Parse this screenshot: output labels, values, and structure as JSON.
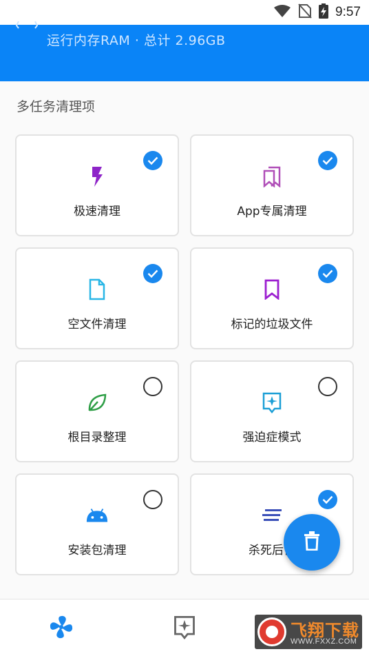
{
  "status_bar": {
    "time": "9:57"
  },
  "header": {
    "subtitle": "运行内存RAM · 总计 2.96GB"
  },
  "section": {
    "title": "多任务清理项"
  },
  "cards": [
    {
      "label": "极速清理",
      "checked": true,
      "icon": "lightning-icon",
      "icon_color": "#8e24c8"
    },
    {
      "label": "App专属清理",
      "checked": true,
      "icon": "bookmarks-icon",
      "icon_color": "#b04fb8"
    },
    {
      "label": "空文件清理",
      "checked": true,
      "icon": "file-icon",
      "icon_color": "#29b6e6"
    },
    {
      "label": "标记的垃圾文件",
      "checked": true,
      "icon": "bookmark-icon",
      "icon_color": "#9c1fd0"
    },
    {
      "label": "根目录整理",
      "checked": false,
      "icon": "leaf-icon",
      "icon_color": "#2e9e46"
    },
    {
      "label": "强迫症模式",
      "checked": false,
      "icon": "sparkle-box-icon",
      "icon_color": "#1c9fd6"
    },
    {
      "label": "安装包清理",
      "checked": false,
      "icon": "android-icon",
      "icon_color": "#1a88ee"
    },
    {
      "label": "杀死后台",
      "checked": true,
      "icon": "lines-icon",
      "icon_color": "#3a4fb8"
    }
  ],
  "colors": {
    "accent": "#1a88ee",
    "header": "#0a84f7"
  },
  "watermark": {
    "brand": "飞翔下载",
    "url": "WWW.FXXZ.COM"
  }
}
